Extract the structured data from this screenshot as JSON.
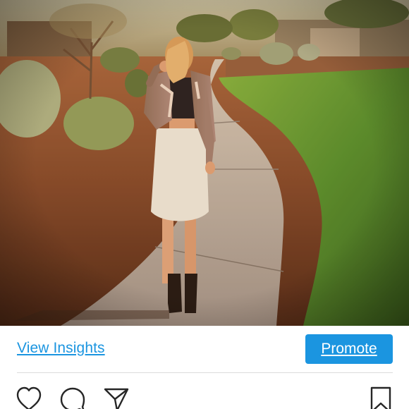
{
  "post": {
    "image_alt": "Woman in a leather jacket, crop top, white pencil skirt and black ankle boots standing on a curved sidewalk beside desert landscaping and a green lawn at sunset",
    "view_insights_label": "View Insights",
    "promote_label": "Promote"
  },
  "actions": {
    "like_icon": "heart-icon",
    "comment_icon": "comment-icon",
    "share_icon": "paper-plane-icon",
    "save_icon": "bookmark-icon"
  },
  "colors": {
    "accent": "#1b95e0",
    "icon": "#262626",
    "divider": "#dbdbdb"
  }
}
